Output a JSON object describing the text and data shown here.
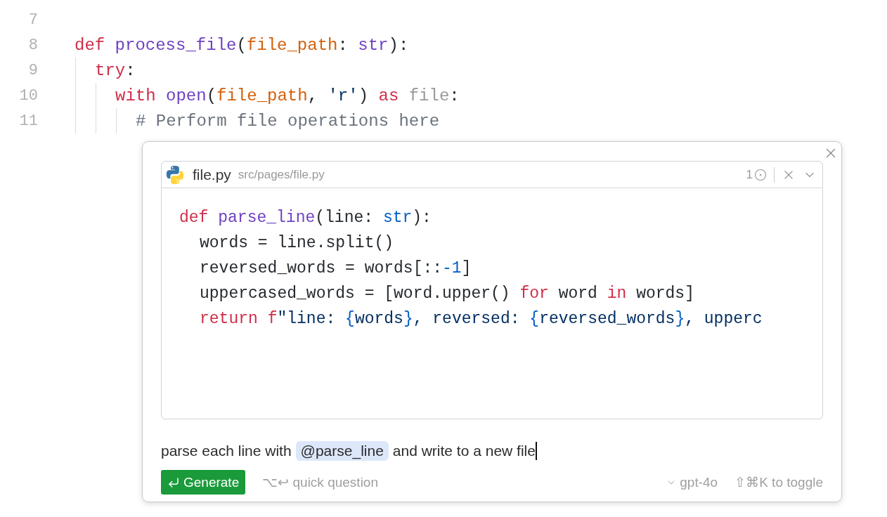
{
  "editor": {
    "lines": [
      {
        "number": "7"
      },
      {
        "number": "8",
        "tokens": [
          {
            "t": "def ",
            "kind": "keyword"
          },
          {
            "t": "process_file",
            "kind": "function"
          },
          {
            "t": "(",
            "kind": "plain"
          },
          {
            "t": "file_path",
            "kind": "param"
          },
          {
            "t": ": ",
            "kind": "plain"
          },
          {
            "t": "str",
            "kind": "function"
          },
          {
            "t": "):",
            "kind": "plain"
          }
        ],
        "children": [
          {
            "number": "9",
            "tokens": [
              {
                "t": "try",
                "kind": "keyword"
              },
              {
                "t": ":",
                "kind": "plain"
              }
            ],
            "children": [
              {
                "number": "10",
                "tokens": [
                  {
                    "t": "with ",
                    "kind": "keyword"
                  },
                  {
                    "t": "open",
                    "kind": "function"
                  },
                  {
                    "t": "(",
                    "kind": "plain"
                  },
                  {
                    "t": "file_path",
                    "kind": "param"
                  },
                  {
                    "t": ", ",
                    "kind": "plain"
                  },
                  {
                    "t": "'r'",
                    "kind": "string"
                  },
                  {
                    "t": ") ",
                    "kind": "plain"
                  },
                  {
                    "t": "as ",
                    "kind": "keyword"
                  },
                  {
                    "t": "file",
                    "kind": "muted"
                  },
                  {
                    "t": ":",
                    "kind": "plain"
                  }
                ],
                "children": [
                  {
                    "number": "11",
                    "tokens": [
                      {
                        "t": "# Perform file operations here",
                        "kind": "comment"
                      }
                    ]
                  }
                ]
              }
            ]
          }
        ]
      }
    ]
  },
  "inline_prompt": {
    "file_card": {
      "name": "file.py",
      "path": "src/pages/file.py",
      "count": "1",
      "lines": [
        {
          "tokens": [
            {
              "t": "def ",
              "kind": "keyword"
            },
            {
              "t": "parse_line",
              "kind": "function"
            },
            {
              "t": "(line: ",
              "kind": "plain"
            },
            {
              "t": "str",
              "kind": "builtin"
            },
            {
              "t": "):",
              "kind": "plain"
            }
          ],
          "children": [
            {
              "tokens": [
                {
                  "t": "words = line.split()",
                  "kind": "plain"
                }
              ]
            },
            {
              "tokens": [
                {
                  "t": "reversed_words = words[::",
                  "kind": "plain"
                },
                {
                  "t": "-1",
                  "kind": "builtin"
                },
                {
                  "t": "]",
                  "kind": "plain"
                }
              ]
            },
            {
              "tokens": [
                {
                  "t": "uppercased_words = [word.upper() ",
                  "kind": "plain"
                },
                {
                  "t": "for ",
                  "kind": "keyword"
                },
                {
                  "t": "word ",
                  "kind": "plain"
                },
                {
                  "t": "in ",
                  "kind": "keyword"
                },
                {
                  "t": "words]",
                  "kind": "plain"
                }
              ]
            },
            {
              "tokens": [
                {
                  "t": "return ",
                  "kind": "keyword"
                },
                {
                  "t": "f",
                  "kind": "keyword"
                },
                {
                  "t": "\"line: ",
                  "kind": "string"
                },
                {
                  "t": "{",
                  "kind": "builtin"
                },
                {
                  "t": "words",
                  "kind": "string"
                },
                {
                  "t": "}",
                  "kind": "builtin"
                },
                {
                  "t": ", reversed: ",
                  "kind": "string"
                },
                {
                  "t": "{",
                  "kind": "builtin"
                },
                {
                  "t": "reversed_words",
                  "kind": "string"
                },
                {
                  "t": "}",
                  "kind": "builtin"
                },
                {
                  "t": ", upperc",
                  "kind": "string"
                }
              ]
            }
          ]
        }
      ]
    },
    "prompt": [
      {
        "t": "parse each line with",
        "kind": "text"
      },
      {
        "t": "@parse_line",
        "kind": "mention"
      },
      {
        "t": "and write to a new file",
        "kind": "text"
      }
    ],
    "generate_button": "Generate",
    "quick_question": {
      "keys": "⌥↩",
      "label": "quick question"
    },
    "model": "gpt-4o",
    "toggle_hint": "⇧⌘K to toggle"
  }
}
